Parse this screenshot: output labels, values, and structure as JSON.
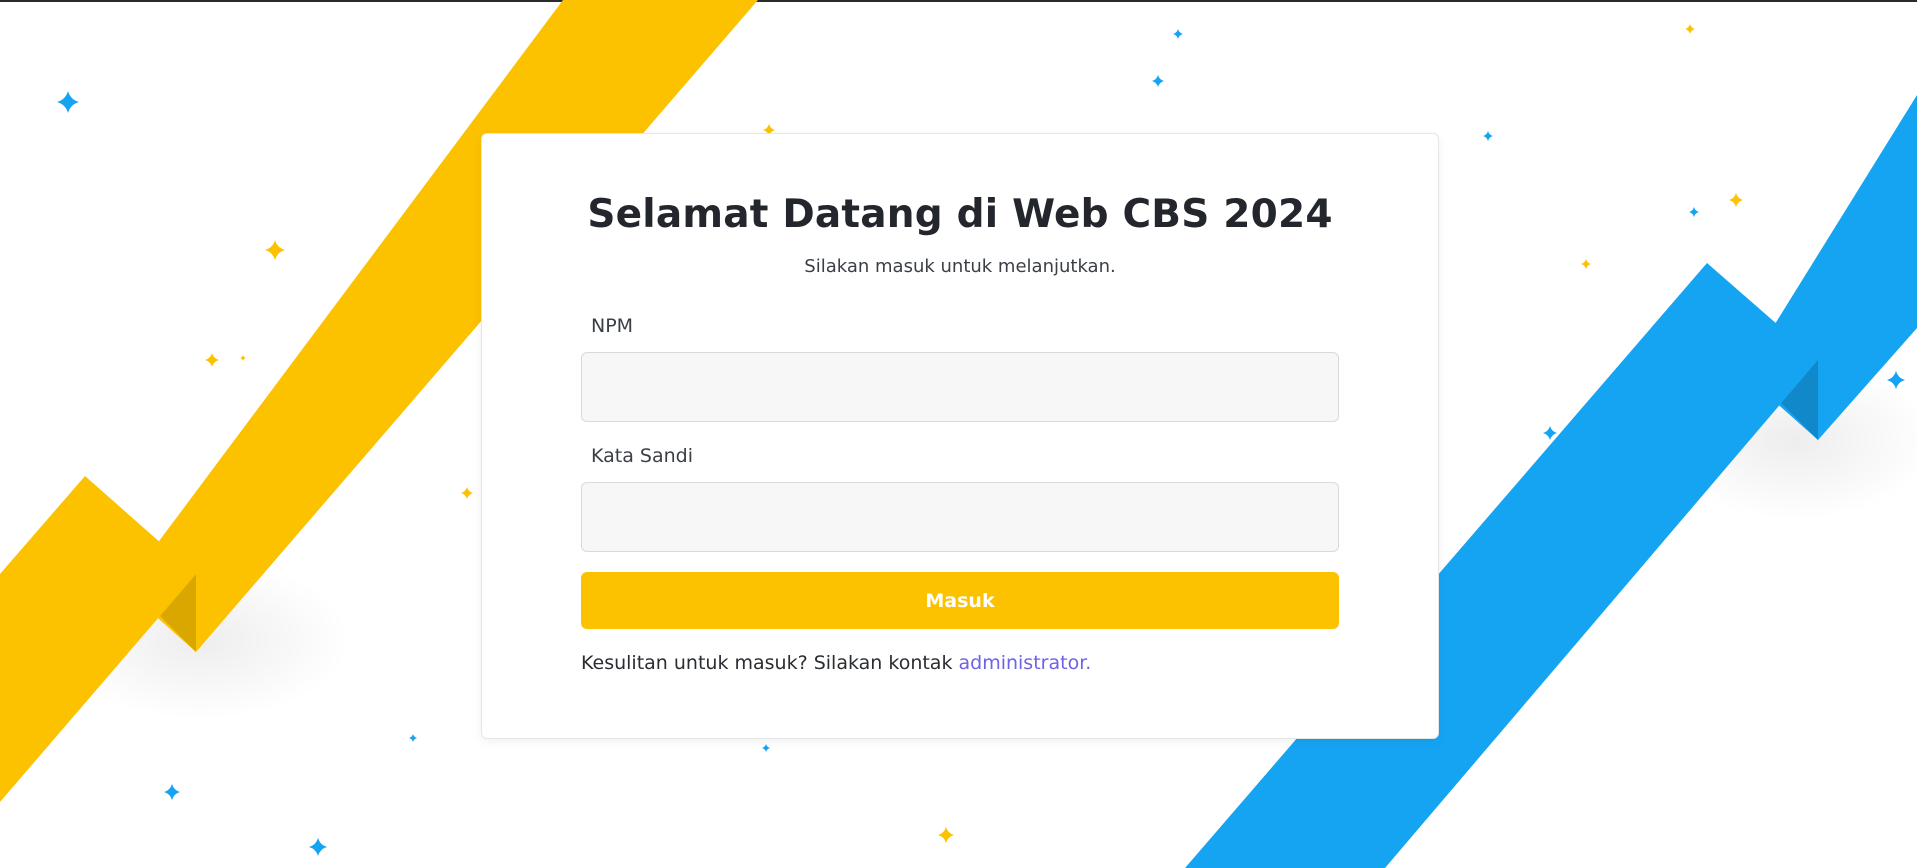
{
  "login": {
    "title": "Selamat Datang di Web CBS 2024",
    "subtitle": "Silakan masuk untuk melanjutkan.",
    "npm_label": "NPM",
    "npm_value": "",
    "password_label": "Kata Sandi",
    "password_value": "",
    "submit_label": "Masuk",
    "help_text": "Kesulitan untuk masuk? Silakan kontak ",
    "help_link": "administrator."
  },
  "theme": {
    "background": "#ffffff",
    "ribbon_yellow": "#fcc200",
    "ribbon_yellow_shade": "#d9a700",
    "ribbon_blue": "#15a4f2",
    "ribbon_blue_shade": "#1188c9",
    "button": "#fcc200",
    "link": "#6c63e6"
  },
  "decor": {
    "stars": "sparkle-star-icon"
  }
}
